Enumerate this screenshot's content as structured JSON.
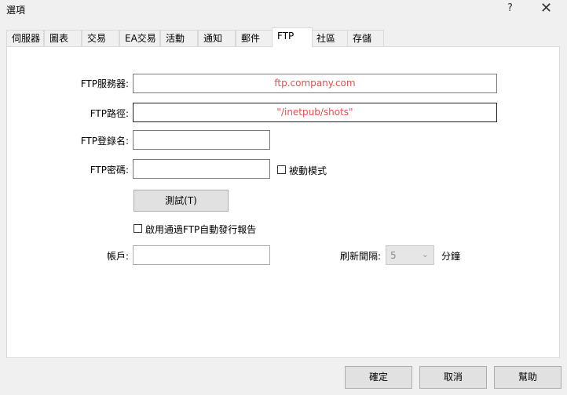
{
  "window": {
    "title": "選項",
    "help_label": "?",
    "close_label": "✕"
  },
  "tabs": [
    {
      "label": "伺服器"
    },
    {
      "label": "圖表"
    },
    {
      "label": "交易"
    },
    {
      "label": "EA交易"
    },
    {
      "label": "活動"
    },
    {
      "label": "通知"
    },
    {
      "label": "郵件"
    },
    {
      "label": "FTP",
      "active": true
    },
    {
      "label": "社區"
    },
    {
      "label": "存儲"
    }
  ],
  "ftp": {
    "server_label": "FTP服務器:",
    "server_value": "ftp.company.com",
    "path_label": "FTP路徑:",
    "path_value": "\"/inetpub/shots\"",
    "login_label": "FTP登錄名:",
    "login_value": "",
    "password_label": "FTP密碼:",
    "password_value": "",
    "passive_label": "被動模式",
    "test_button": "測試(T)",
    "enable_label": "啟用通過FTP自動發行報告",
    "account_label": "帳戶:",
    "account_value": "",
    "refresh_label": "刷新間隔:",
    "refresh_value": "5",
    "minutes_label": "分鐘"
  },
  "footer": {
    "ok": "確定",
    "cancel": "取消",
    "help": "幫助"
  }
}
